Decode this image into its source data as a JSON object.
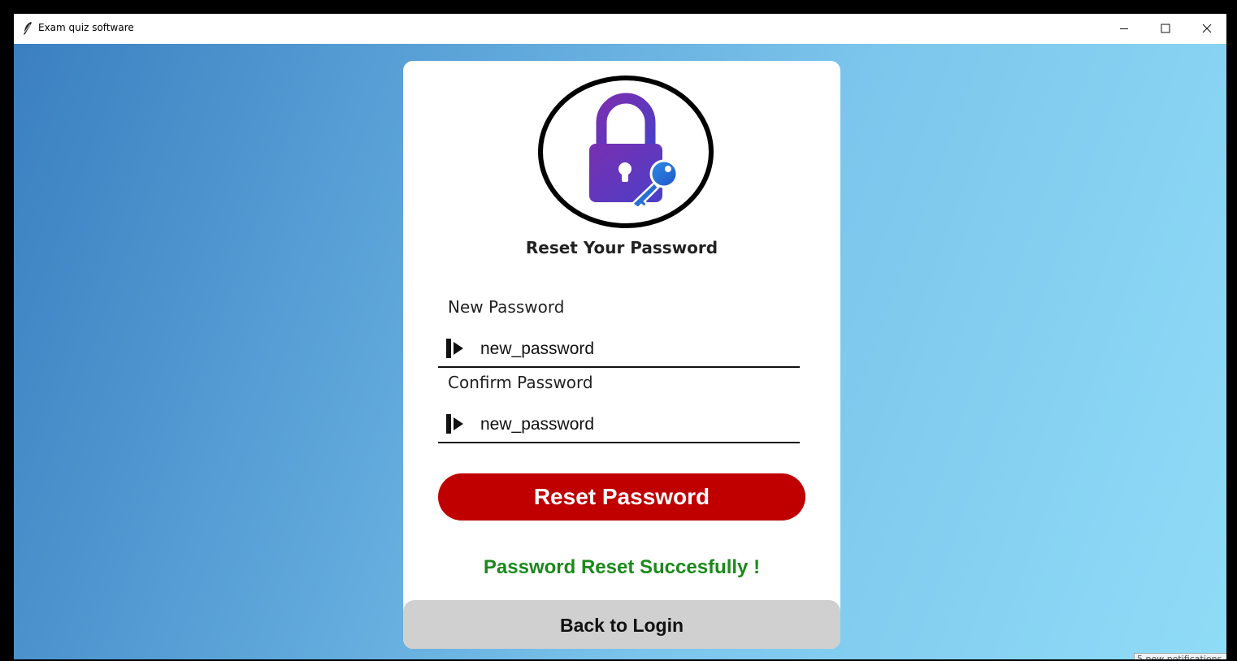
{
  "window": {
    "title": "Exam quiz software",
    "controls": {
      "minimize_icon": "minimize-icon",
      "maximize_icon": "maximize-icon",
      "close_icon": "close-icon"
    }
  },
  "card": {
    "logo_icon": "padlock-key-icon",
    "heading": "Reset Your Password",
    "new_password": {
      "label": "New Password",
      "value": "new_password",
      "icon": "login-arrow-icon"
    },
    "confirm_password": {
      "label": "Confirm Password",
      "value": "new_password",
      "icon": "login-arrow-icon"
    },
    "reset_button": "Reset Password",
    "status_message": "Password Reset Succesfully !",
    "back_button": "Back to Login"
  },
  "notification": "5 new notifications",
  "colors": {
    "reset_button": "#c00000",
    "status_message": "#1a8a1a",
    "back_button": "#d0d0d0",
    "background_start": "#3b7fc0",
    "background_end": "#8fdcf7",
    "lock_purple": "#6a2fb8",
    "key_blue": "#2a6fd8"
  }
}
